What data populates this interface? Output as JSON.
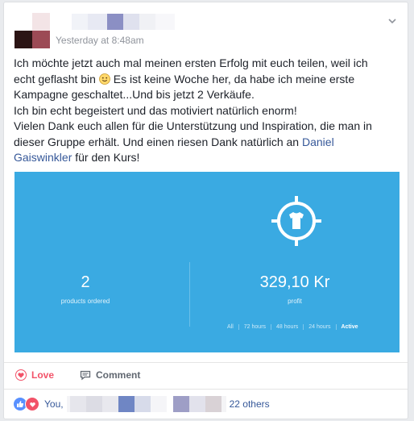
{
  "post": {
    "timestamp": "Yesterday at 8:48am",
    "text": {
      "l1": "Ich möchte jetzt auch mal meinen ersten Erfolg mit euch teilen, weil ich",
      "l2a": "echt geflasht bin",
      "l2b": "Es ist keine Woche her, da habe ich meine erste",
      "l3": "Kampagne geschaltet...Und bis jetzt 2 Verkäufe.",
      "l4": "Ich bin echt begeistert und das motiviert natürlich enorm!",
      "l5": "Vielen Dank euch allen für die Unterstützung und Inspiration, die man in",
      "l6a": "dieser Gruppe erhält. Und einen riesen Dank natürlich an",
      "link_1": "Daniel",
      "link_2": "Gaiswinkler",
      "l7b": "für den Kurs!"
    }
  },
  "stats_panel": {
    "products_value": "2",
    "products_label": "products ordered",
    "profit_value": "329,10 Kr",
    "profit_label": "profit",
    "filters": [
      "All",
      "72 hours",
      "48 hours",
      "24 hours",
      "Active"
    ],
    "active_filter": "Active",
    "icon": "target-shirt-icon",
    "background_color": "#3aaae2"
  },
  "actions": {
    "love_label": "Love",
    "comment_label": "Comment"
  },
  "reactions": {
    "you_label": "You,",
    "others_label": "22 others"
  },
  "colors": {
    "love_accent": "#f25268",
    "link_blue": "#365899",
    "like_blue": "#5890ff"
  }
}
